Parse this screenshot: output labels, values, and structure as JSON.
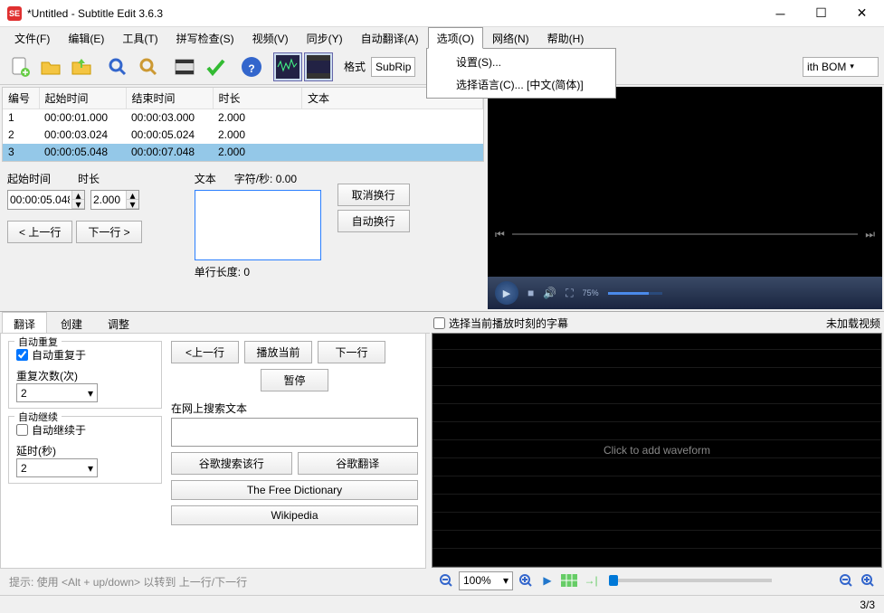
{
  "title": "*Untitled - Subtitle Edit 3.6.3",
  "app_icon": "SE",
  "menubar": [
    "文件(F)",
    "编辑(E)",
    "工具(T)",
    "拼写检查(S)",
    "视频(V)",
    "同步(Y)",
    "自动翻译(A)",
    "选项(O)",
    "网络(N)",
    "帮助(H)"
  ],
  "dropdown": {
    "settings": "设置(S)...",
    "language": "选择语言(C)... [中文(简体)]"
  },
  "toolbar": {
    "format_label": "格式",
    "format_value": "SubRip",
    "encoding_value": "ith BOM"
  },
  "grid": {
    "headers": {
      "num": "编号",
      "start": "起始时间",
      "end": "结束时间",
      "dur": "时长",
      "text": "文本"
    },
    "rows": [
      {
        "n": "1",
        "s": "00:00:01.000",
        "e": "00:00:03.000",
        "d": "2.000",
        "t": ""
      },
      {
        "n": "2",
        "s": "00:00:03.024",
        "e": "00:00:05.024",
        "d": "2.000",
        "t": ""
      },
      {
        "n": "3",
        "s": "00:00:05.048",
        "e": "00:00:07.048",
        "d": "2.000",
        "t": ""
      }
    ]
  },
  "edit": {
    "start_label": "起始时间",
    "dur_label": "时长",
    "start_val": "00:00:05.048",
    "dur_val": "2.000",
    "prev": "< 上一行",
    "next": "下一行 >",
    "text_label": "文本",
    "chars_label": "字符/秒: 0.00",
    "line_len": "单行长度: 0",
    "cancel_wrap": "取消换行",
    "auto_wrap": "自动换行"
  },
  "controls": {
    "time": "",
    "vol": "75%"
  },
  "tabs": {
    "translate": "翻译",
    "create": "创建",
    "adjust": "调整"
  },
  "panel": {
    "auto_repeat": "自动重复",
    "auto_repeat_on": "自动重复于",
    "repeat_count": "重复次数(次)",
    "repeat_val": "2",
    "auto_continue": "自动继续",
    "auto_continue_on": "自动继续于",
    "delay": "延时(秒)",
    "delay_val": "2",
    "prev": "<上一行",
    "play_cur": "播放当前",
    "next": "下一行",
    "pause": "暂停",
    "search_label": "在网上搜索文本",
    "g_search": "谷歌搜索该行",
    "g_trans": "谷歌翻译",
    "dict": "The Free Dictionary",
    "wiki": "Wikipedia"
  },
  "hint": "提示: 使用 <Alt + up/down> 以转到 上一行/下一行",
  "wave": {
    "checkbox": "选择当前播放时刻的字幕",
    "no_video": "未加载视频",
    "placeholder": "Click to add waveform",
    "zoom": "100%"
  },
  "status": "3/3"
}
